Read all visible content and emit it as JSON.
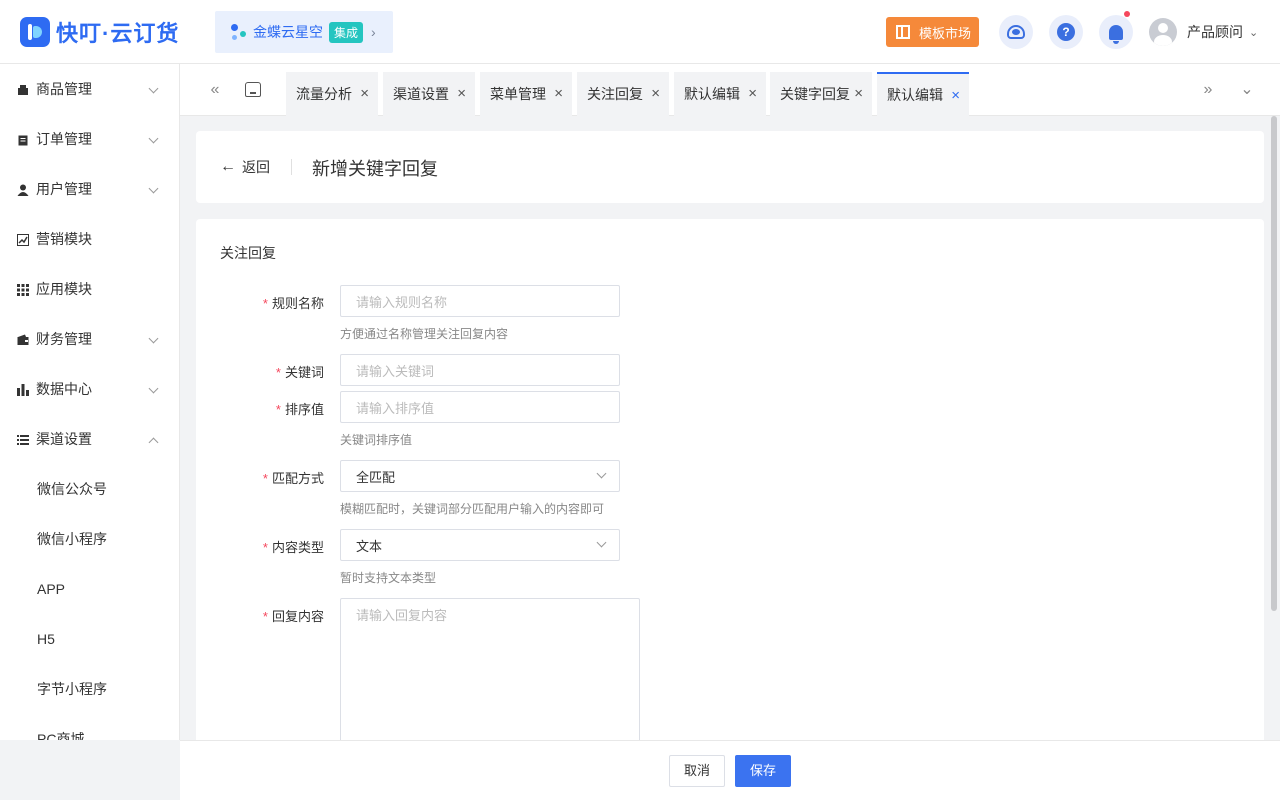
{
  "header": {
    "logo_text": "快叮·云订货",
    "integration": {
      "name": "金蝶云星空",
      "badge": "集成"
    },
    "template_market": "模板市场",
    "user_name": "产品顾问"
  },
  "sidebar": {
    "items": [
      {
        "label": "商品管理",
        "icon": "box-icon",
        "expandable": true
      },
      {
        "label": "订单管理",
        "icon": "clipboard-icon",
        "expandable": true
      },
      {
        "label": "用户管理",
        "icon": "user-icon",
        "expandable": true
      },
      {
        "label": "营销模块",
        "icon": "trend-chart-icon",
        "expandable": false
      },
      {
        "label": "应用模块",
        "icon": "grid-icon",
        "expandable": false
      },
      {
        "label": "财务管理",
        "icon": "wallet-icon",
        "expandable": true
      },
      {
        "label": "数据中心",
        "icon": "bar-chart-icon",
        "expandable": true
      },
      {
        "label": "渠道设置",
        "icon": "list-icon",
        "expandable": true,
        "expanded": true
      }
    ],
    "sub_items": [
      "微信公众号",
      "微信小程序",
      "APP",
      "H5",
      "字节小程序",
      "PC商城"
    ]
  },
  "tabs": [
    {
      "label": "流量分析",
      "active": false
    },
    {
      "label": "渠道设置",
      "active": false
    },
    {
      "label": "菜单管理",
      "active": false
    },
    {
      "label": "关注回复",
      "active": false
    },
    {
      "label": "默认编辑",
      "active": false
    },
    {
      "label": "关键字回复",
      "active": false
    },
    {
      "label": "默认编辑",
      "active": true
    }
  ],
  "page": {
    "back_label": "返回",
    "title": "新增关键字回复",
    "section_title": "关注回复"
  },
  "form": {
    "rule_name": {
      "label": "规则名称",
      "placeholder": "请输入规则名称",
      "help": "方便通过名称管理关注回复内容"
    },
    "keyword": {
      "label": "关键词",
      "placeholder": "请输入关键词"
    },
    "sort_value": {
      "label": "排序值",
      "placeholder": "请输入排序值",
      "help": "关键词排序值"
    },
    "match_mode": {
      "label": "匹配方式",
      "value": "全匹配",
      "help": "模糊匹配时，关键词部分匹配用户输入的内容即可"
    },
    "content_type": {
      "label": "内容类型",
      "value": "文本",
      "help": "暂时支持文本类型"
    },
    "reply_content": {
      "label": "回复内容",
      "placeholder": "请输入回复内容"
    }
  },
  "footer": {
    "cancel_label": "取消",
    "save_label": "保存"
  },
  "colors": {
    "primary": "#2e6bf2",
    "orange": "#f5893a",
    "required": "#f5475d",
    "badge": "#24c5c0"
  }
}
